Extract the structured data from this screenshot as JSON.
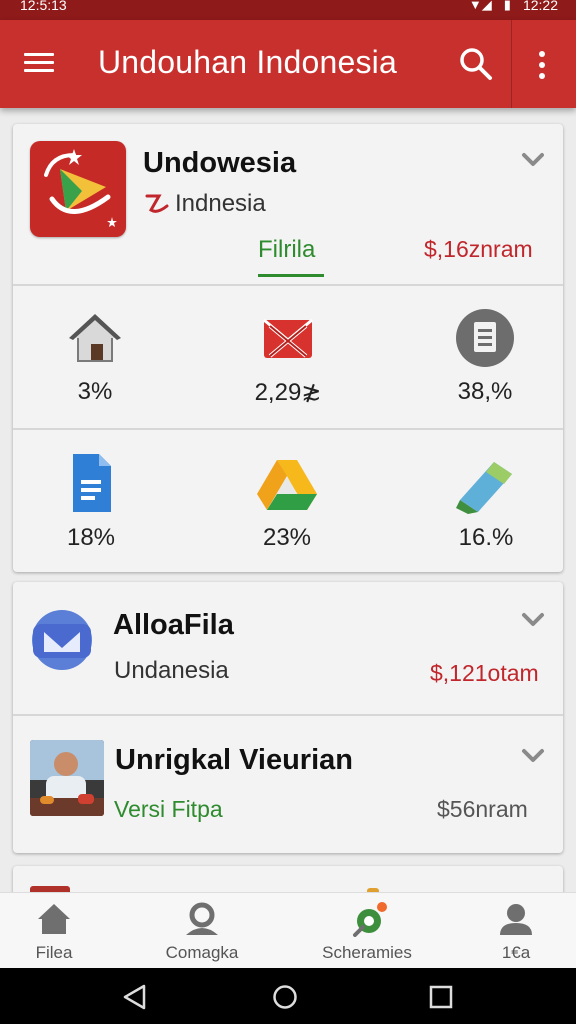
{
  "status_bar": {
    "time_left": "12:5:13",
    "time_right": "12:22"
  },
  "app_bar": {
    "title": "Undouhan Indonesia"
  },
  "featured_card": {
    "title": "Undowesia",
    "subtitle": "Indnesia",
    "tab_label": "Filrila",
    "price": "$,16znram",
    "stats": [
      {
        "icon": "house-icon",
        "value": "3%"
      },
      {
        "icon": "mail-cross-icon",
        "value": "2,29≵"
      },
      {
        "icon": "document-circle-icon",
        "value": "38,%"
      },
      {
        "icon": "docs-icon",
        "value": "18%"
      },
      {
        "icon": "drive-icon",
        "value": "23%"
      },
      {
        "icon": "pencil-icon",
        "value": "16.%"
      }
    ]
  },
  "list_items": [
    {
      "title": "AlloaFila",
      "subtitle": "Undanesia",
      "price": "$,121otam"
    },
    {
      "title": "Unrigkal Vieurian",
      "subtitle": "Versi Fitpa",
      "price": "$56nram"
    }
  ],
  "bottom_nav": [
    {
      "label": "Filea",
      "icon": "home-icon"
    },
    {
      "label": "Comagka",
      "icon": "person-circle-icon"
    },
    {
      "label": "Scheramies",
      "icon": "share-icon"
    },
    {
      "label": "1€a",
      "icon": "account-icon"
    }
  ],
  "colors": {
    "primary": "#c8302e",
    "accent_green": "#2e8b2e",
    "price_red": "#c0262b"
  }
}
